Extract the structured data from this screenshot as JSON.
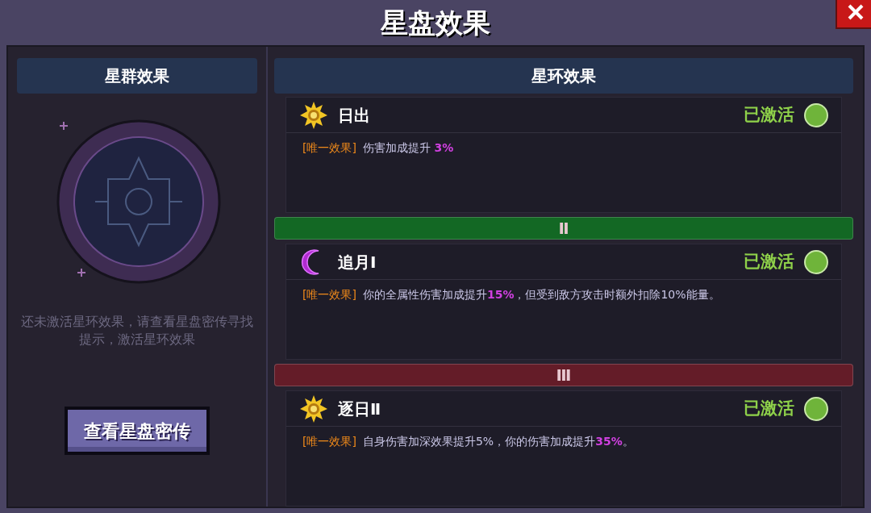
{
  "window": {
    "title": "星盘效果"
  },
  "left_panel": {
    "header": "星群效果",
    "hint": "还未激活星环效果，请查看星盘密传寻找提示，激活星环效果",
    "button": "查看星盘密传"
  },
  "right_panel": {
    "header": "星环效果",
    "entries": [
      {
        "kind": "sun",
        "name": "日出",
        "status": "已激活",
        "active": true,
        "tag": "[唯一效果]",
        "description": "伤害加成提升 **3%**"
      },
      {
        "kind": "tier",
        "label": "Ⅱ",
        "color": "#136824"
      },
      {
        "kind": "moon",
        "name": "追月Ⅰ",
        "status": "已激活",
        "active": true,
        "tag": "[唯一效果]",
        "description": "你的全属性伤害加成提升**15%**，但受到敌方攻击时额外扣除10%能量。"
      },
      {
        "kind": "tier",
        "label": "Ⅲ",
        "color": "#641c28"
      },
      {
        "kind": "sun",
        "name": "逐日Ⅱ",
        "status": "已激活",
        "active": true,
        "tag": "[唯一效果]",
        "description": "自身伤害加深效果提升5%，你的伤害加成提升**35%**。"
      }
    ]
  }
}
